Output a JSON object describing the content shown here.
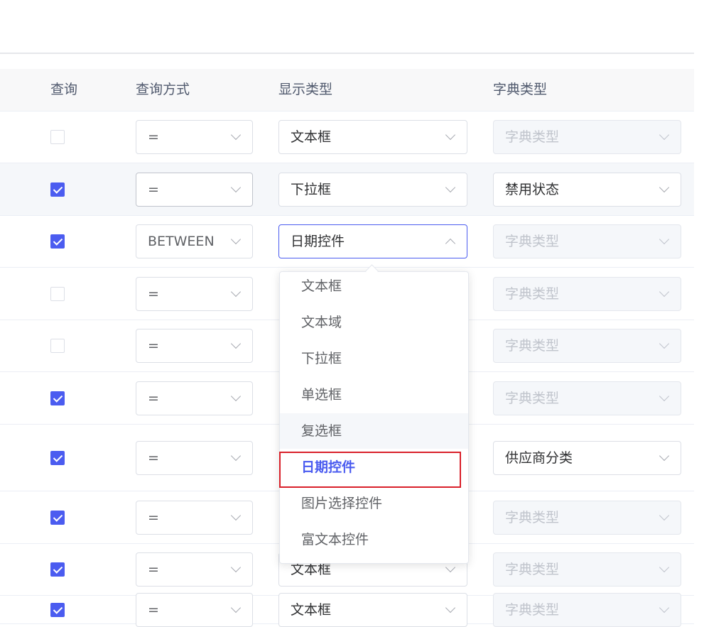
{
  "headers": {
    "query": "查询",
    "query_mode": "查询方式",
    "display_type": "显示类型",
    "dict_type": "字典类型"
  },
  "rows": [
    {
      "query_checked": false,
      "query_mode": "=",
      "display_type": "文本框",
      "dict_type": "字典类型",
      "dict_disabled": true
    },
    {
      "query_checked": true,
      "query_mode": "=",
      "display_type": "下拉框",
      "dict_type": "禁用状态",
      "dict_disabled": false
    },
    {
      "query_checked": true,
      "query_mode": "BETWEEN",
      "display_type": "日期控件",
      "dict_type": "字典类型",
      "dict_disabled": true
    },
    {
      "query_checked": false,
      "query_mode": "=",
      "display_type": "",
      "dict_type": "字典类型",
      "dict_disabled": true
    },
    {
      "query_checked": false,
      "query_mode": "=",
      "display_type": "",
      "dict_type": "字典类型",
      "dict_disabled": true
    },
    {
      "query_checked": true,
      "query_mode": "=",
      "display_type": "",
      "dict_type": "字典类型",
      "dict_disabled": true
    },
    {
      "query_checked": true,
      "query_mode": "=",
      "display_type": "",
      "dict_type": "供应商分类",
      "dict_disabled": false
    },
    {
      "query_checked": true,
      "query_mode": "=",
      "display_type": "",
      "dict_type": "字典类型",
      "dict_disabled": true
    },
    {
      "query_checked": true,
      "query_mode": "=",
      "display_type": "文本框",
      "dict_type": "字典类型",
      "dict_disabled": true
    },
    {
      "query_checked": true,
      "query_mode": "=",
      "display_type": "文本框",
      "dict_type": "字典类型",
      "dict_disabled": true
    }
  ],
  "dropdown": {
    "options": [
      "文本框",
      "文本域",
      "下拉框",
      "单选框",
      "复选框",
      "日期控件",
      "图片选择控件",
      "富文本控件"
    ],
    "selected": "日期控件",
    "hovered": "复选框"
  },
  "colors": {
    "accent": "#4b5cf0",
    "highlight": "#d9202a"
  }
}
